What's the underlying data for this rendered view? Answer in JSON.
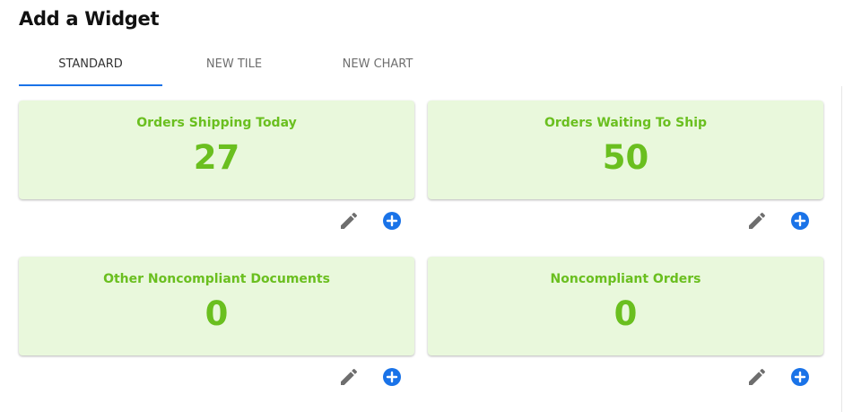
{
  "page": {
    "title": "Add a Widget"
  },
  "tabs": [
    {
      "label": "STANDARD",
      "active": true
    },
    {
      "label": "NEW TILE",
      "active": false
    },
    {
      "label": "NEW CHART",
      "active": false
    }
  ],
  "widgets": [
    {
      "title": "Orders Shipping Today",
      "value": "27"
    },
    {
      "title": "Orders Waiting To Ship",
      "value": "50"
    },
    {
      "title": "Other Noncompliant Documents",
      "value": "0"
    },
    {
      "title": "Noncompliant Orders",
      "value": "0"
    }
  ],
  "icons": {
    "edit": "pencil-icon",
    "add": "plus-circle-icon"
  },
  "colors": {
    "tile_background": "#e9f8dc",
    "tile_text": "#6abf1f",
    "accent_blue": "#1a73e8",
    "edit_icon": "#6e6e6e"
  }
}
